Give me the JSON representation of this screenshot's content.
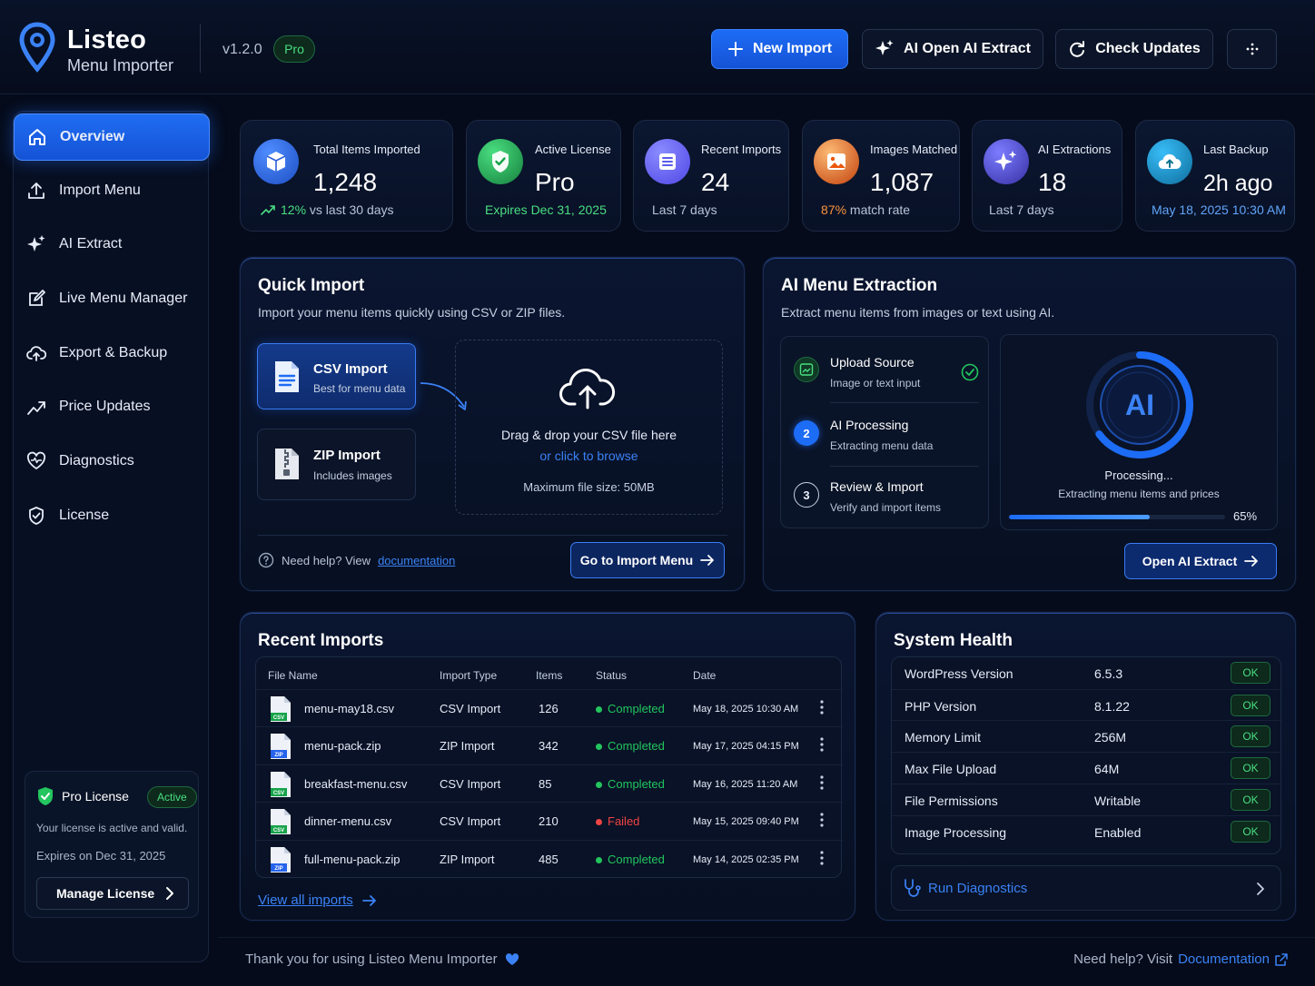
{
  "header": {
    "brand_name": "Listeo",
    "brand_sub": "Menu Importer",
    "version": "v1.2.0",
    "badge": "Pro",
    "buttons": {
      "new_import": "New Import",
      "ai_extract": "AI Open AI Extract",
      "check_updates": "Check Updates"
    }
  },
  "sidebar": {
    "items": [
      {
        "label": "Overview",
        "icon": "home-icon",
        "active": true
      },
      {
        "label": "Import Menu",
        "icon": "upload-icon"
      },
      {
        "label": "AI Extract",
        "icon": "sparkles-icon"
      },
      {
        "label": "Live Menu Manager",
        "icon": "edit-icon"
      },
      {
        "label": "Export & Backup",
        "icon": "cloud-upload-icon"
      },
      {
        "label": "Price Updates",
        "icon": "trend-icon"
      },
      {
        "label": "Diagnostics",
        "icon": "heart-pulse-icon"
      },
      {
        "label": "License",
        "icon": "shield-check-icon"
      }
    ],
    "license": {
      "title": "Pro License",
      "status": "Active",
      "message": "Your license is active and valid.",
      "expires": "Expires on Dec 31, 2025",
      "button": "Manage License"
    }
  },
  "stats": [
    {
      "label": "Total Items Imported",
      "value": "1,248",
      "sub_hl": "12%",
      "sub": " vs last 30 days",
      "color": "#3b82f6"
    },
    {
      "label": "Active License",
      "value": "Pro",
      "sub_hl": "Expires Dec 31, 2025",
      "sub": "",
      "color": "#22c55e"
    },
    {
      "label": "Recent Imports",
      "value": "24",
      "sub_hl": "",
      "sub": "Last 7 days",
      "color": "#6366f1"
    },
    {
      "label": "Images Matched",
      "value": "1,087",
      "sub_hl": "87%",
      "sub": " match rate",
      "color": "#f97316"
    },
    {
      "label": "AI Extractions",
      "value": "18",
      "sub_hl": "",
      "sub": "Last 7 days",
      "color": "#4f46e5"
    },
    {
      "label": "Last Backup",
      "value": "2h ago",
      "sub_hl": "May 18, 2025 10:30 AM",
      "sub": "",
      "color": "#0ea5e9"
    }
  ],
  "quick_import": {
    "title": "Quick Import",
    "desc": "Import your menu items quickly using CSV or ZIP files.",
    "csv": {
      "name": "CSV Import",
      "desc": "Best for menu data"
    },
    "zip": {
      "name": "ZIP Import",
      "desc": "Includes images"
    },
    "drop": {
      "line1": "Drag & drop your CSV file here",
      "line2": "or click to browse",
      "line3": "Maximum file size: 50MB"
    },
    "help_text": "Need help? View",
    "help_link": "documentation",
    "button": "Go to Import Menu"
  },
  "ai_extraction": {
    "title": "AI Menu Extraction",
    "desc": "Extract menu items from images or text using AI.",
    "steps": [
      {
        "title": "Upload Source",
        "sub": "Image or text input",
        "num": ""
      },
      {
        "title": "AI Processing",
        "sub": "Extracting menu data",
        "num": "2"
      },
      {
        "title": "Review & Import",
        "sub": "Verify and import items",
        "num": "3"
      }
    ],
    "ring_label": "AI",
    "status": "Processing...",
    "status_sub": "Extracting menu items and prices",
    "progress": 65,
    "progress_label": "65%",
    "button": "Open AI Extract"
  },
  "recent_imports": {
    "title": "Recent Imports",
    "columns": [
      "File Name",
      "Import Type",
      "Items",
      "Status",
      "Date"
    ],
    "rows": [
      {
        "file": "menu-may18.csv",
        "ext": "CSV",
        "type": "CSV Import",
        "items": "126",
        "status": "Completed",
        "date": "May 18, 2025 10:30 AM"
      },
      {
        "file": "menu-pack.zip",
        "ext": "ZIP",
        "type": "ZIP Import",
        "items": "342",
        "status": "Completed",
        "date": "May 17, 2025 04:15 PM"
      },
      {
        "file": "breakfast-menu.csv",
        "ext": "CSV",
        "type": "CSV Import",
        "items": "85",
        "status": "Completed",
        "date": "May 16, 2025 11:20 AM"
      },
      {
        "file": "dinner-menu.csv",
        "ext": "CSV",
        "type": "CSV Import",
        "items": "210",
        "status": "Failed",
        "date": "May 15, 2025 09:40 PM"
      },
      {
        "file": "full-menu-pack.zip",
        "ext": "ZIP",
        "type": "ZIP Import",
        "items": "485",
        "status": "Completed",
        "date": "May 14, 2025 02:35 PM"
      }
    ],
    "view_all": "View all imports"
  },
  "system_health": {
    "title": "System Health",
    "rows": [
      {
        "label": "WordPress Version",
        "value": "6.5.3",
        "status": "OK"
      },
      {
        "label": "PHP Version",
        "value": "8.1.22",
        "status": "OK"
      },
      {
        "label": "Memory Limit",
        "value": "256M",
        "status": "OK"
      },
      {
        "label": "Max File Upload",
        "value": "64M",
        "status": "OK"
      },
      {
        "label": "File Permissions",
        "value": "Writable",
        "status": "OK"
      },
      {
        "label": "Image Processing",
        "value": "Enabled",
        "status": "OK"
      }
    ],
    "diagnostics": "Run Diagnostics"
  },
  "footer": {
    "thanks": "Thank you for using Listeo Menu Importer",
    "help": "Need help? Visit",
    "link": "Documentation"
  },
  "colors": {
    "accent": "#1d6cf5",
    "success": "#22c55e",
    "danger": "#ef4444",
    "bg": "#050b1a"
  }
}
